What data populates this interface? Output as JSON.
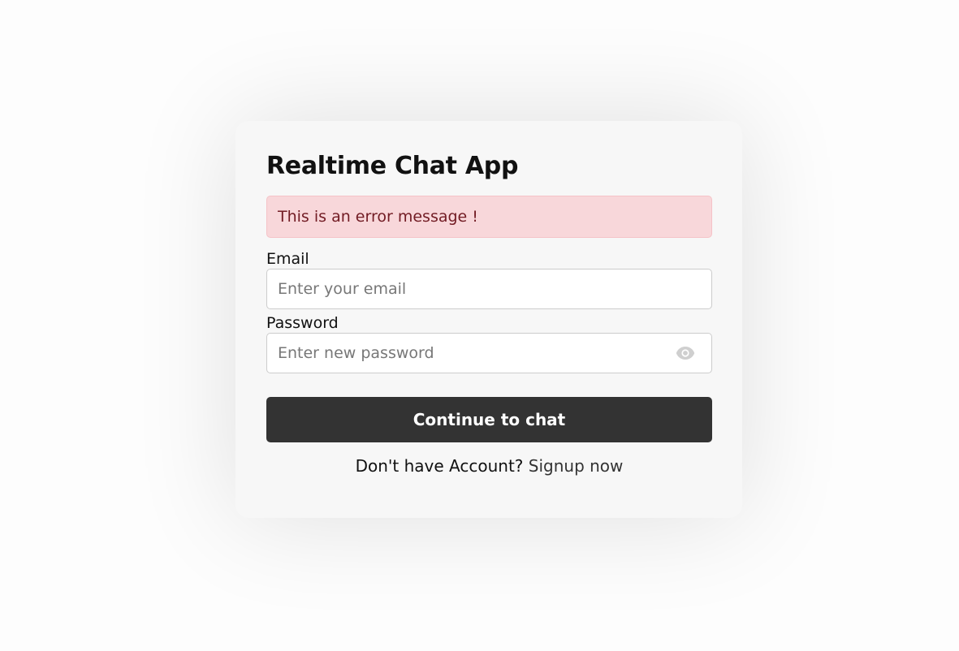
{
  "form": {
    "title": "Realtime Chat App",
    "error_message": "This is an error message !",
    "email": {
      "label": "Email",
      "placeholder": "Enter your email",
      "value": ""
    },
    "password": {
      "label": "Password",
      "placeholder": "Enter new password",
      "value": "",
      "toggle_icon": "eye-icon"
    },
    "submit_label": "Continue to chat",
    "signup_prompt": "Don't have Account?",
    "signup_link": "Signup now"
  },
  "colors": {
    "card_background": "#f7f7f7",
    "error_background": "#f8d7da",
    "error_text": "#721c24",
    "button_background": "#333333",
    "button_text": "#ffffff"
  }
}
